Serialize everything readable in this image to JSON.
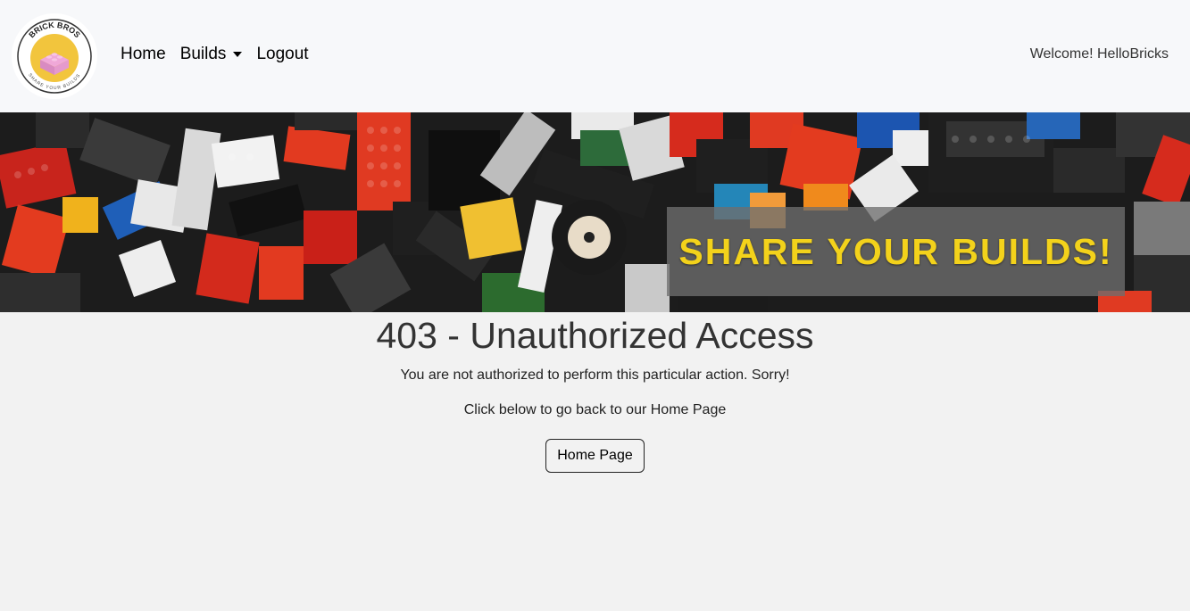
{
  "logo": {
    "top_text": "BRICK BROS",
    "bottom_text": "SHARE YOUR BUILDS"
  },
  "nav": {
    "home": "Home",
    "builds": "Builds",
    "logout": "Logout",
    "welcome": "Welcome! HelloBricks"
  },
  "banner": {
    "tagline": "SHARE YOUR BUILDS!"
  },
  "error": {
    "title": "403 - Unauthorized Access",
    "message": "You are not authorized to perform this particular action. Sorry!",
    "sub": "Click below to go back to our Home Page",
    "button": "Home Page"
  },
  "colors": {
    "tagline": "#f3d21b",
    "page_bg": "#f2f2f2",
    "nav_bg": "#f7f8fa"
  }
}
